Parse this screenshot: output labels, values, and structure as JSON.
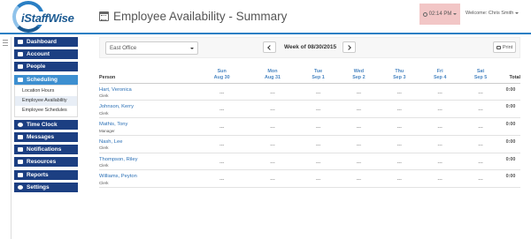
{
  "header": {
    "logo_text": "iStaffWise",
    "page_title": "Employee Availability - Summary",
    "time": "02:14 PM",
    "welcome": "Welcome: Chris Smith"
  },
  "sidebar": {
    "items": [
      {
        "label": "Dashboard",
        "icon": "dashboard-icon"
      },
      {
        "label": "Account",
        "icon": "users-icon"
      },
      {
        "label": "People",
        "icon": "user-icon"
      },
      {
        "label": "Scheduling",
        "icon": "calendar-icon",
        "active": true
      },
      {
        "label": "Time Clock",
        "icon": "clock-icon"
      },
      {
        "label": "Messages",
        "icon": "messages-icon"
      },
      {
        "label": "Notifications",
        "icon": "bell-icon"
      },
      {
        "label": "Resources",
        "icon": "folder-icon"
      },
      {
        "label": "Reports",
        "icon": "reports-icon"
      },
      {
        "label": "Settings",
        "icon": "gear-icon"
      }
    ],
    "sub_items": [
      {
        "label": "Location Hours"
      },
      {
        "label": "Employee Availability",
        "active": true
      },
      {
        "label": "Employee Schedules"
      }
    ]
  },
  "toolbar": {
    "office_value": "East Office",
    "week_label": "Week of 08/30/2015",
    "print_label": "Print"
  },
  "table": {
    "person_header": "Person",
    "total_header": "Total",
    "days": [
      {
        "day": "Sun",
        "date": "Aug 30"
      },
      {
        "day": "Mon",
        "date": "Aug 31"
      },
      {
        "day": "Tue",
        "date": "Sep 1"
      },
      {
        "day": "Wed",
        "date": "Sep 2"
      },
      {
        "day": "Thu",
        "date": "Sep 3"
      },
      {
        "day": "Fri",
        "date": "Sep 4"
      },
      {
        "day": "Sat",
        "date": "Sep 5"
      }
    ],
    "rows": [
      {
        "name": "Hart, Veronica",
        "role": "Clerk",
        "cells": [
          "---",
          "---",
          "---",
          "---",
          "---",
          "---",
          "---"
        ],
        "total": "0:00"
      },
      {
        "name": "Johnson, Kerry",
        "role": "Clerk",
        "cells": [
          "---",
          "---",
          "---",
          "---",
          "---",
          "---",
          "---"
        ],
        "total": "0:00"
      },
      {
        "name": "Mathis, Tony",
        "role": "Manager",
        "cells": [
          "---",
          "---",
          "---",
          "---",
          "---",
          "---",
          "---"
        ],
        "total": "0:00"
      },
      {
        "name": "Nash, Lee",
        "role": "Clerk",
        "cells": [
          "---",
          "---",
          "---",
          "---",
          "---",
          "---",
          "---"
        ],
        "total": "0:00"
      },
      {
        "name": "Thompson, Riley",
        "role": "Clerk",
        "cells": [
          "---",
          "---",
          "---",
          "---",
          "---",
          "---",
          "---"
        ],
        "total": "0:00"
      },
      {
        "name": "Williams, Peyton",
        "role": "Clerk",
        "cells": [
          "---",
          "---",
          "---",
          "---",
          "---",
          "---",
          "---"
        ],
        "total": "0:00"
      }
    ]
  },
  "colors": {
    "accent": "#2a7fc4",
    "nav": "#1c3f82",
    "nav_active": "#3d8fd0",
    "link": "#2a6fb5",
    "time_bg": "#f2c6c6"
  }
}
